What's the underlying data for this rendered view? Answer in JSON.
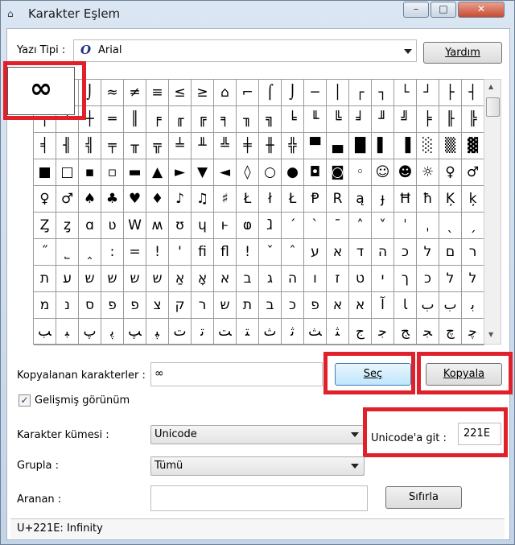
{
  "window": {
    "title": "Karakter Eşlem",
    "minimize": "–",
    "maximize": "□",
    "close": "✕"
  },
  "font": {
    "label": "Yazı Tipi :",
    "value": "Arial",
    "icon_glyph": "O",
    "help_button": "Yardım"
  },
  "grid": {
    "zoom_char": "∞",
    "rows": [
      [
        "",
        "∩",
        "⌡",
        "≈",
        "≠",
        "≡",
        "≤",
        "≥",
        "⌂",
        "⌐",
        "⌠",
        "⌡",
        "─",
        "│",
        "┌",
        "┐",
        "└",
        "┘",
        "├",
        "┤"
      ],
      [
        "┬",
        "┴",
        "┼",
        "═",
        "║",
        "╒",
        "╓",
        "╔",
        "╕",
        "╖",
        "╗",
        "╘",
        "╙",
        "╚",
        "╛",
        "╜",
        "╝",
        "╞",
        "╟",
        "╠"
      ],
      [
        "╡",
        "╢",
        "╣",
        "╤",
        "╥",
        "╦",
        "╧",
        "╨",
        "╩",
        "╪",
        "╫",
        "╬",
        "▀",
        "▄",
        "█",
        "▌",
        "▐",
        "░",
        "▒",
        "▓"
      ],
      [
        "■",
        "□",
        "▪",
        "▫",
        "▬",
        "▲",
        "►",
        "▼",
        "◄",
        "◊",
        "○",
        "●",
        "◘",
        "◙",
        "◦",
        "☺",
        "☻",
        "☼",
        "♀",
        "♂"
      ],
      [
        "♀",
        "♂",
        "♠",
        "♣",
        "♥",
        "♦",
        "♪",
        "♫",
        "♯",
        "Ł",
        "ł",
        "Ł",
        "Ᵽ",
        "R",
        "ą",
        "ɟ",
        "Ħ",
        "ħ",
        "Ķ",
        "ķ"
      ],
      [
        "Ȥ",
        "ȥ",
        "ɑ",
        "ʋ",
        "W",
        "ʍ",
        "ʊ",
        "ɥ",
        "ⱶ",
        "ⱷ",
        "ⱹ",
        "ˊ",
        "ˋ",
        "ˉ",
        "˄",
        "˅",
        "ˈ",
        "ˌ",
        "ˎ",
        "ˏ"
      ],
      [
        "˝",
        "˾",
        "‸",
        ":",
        "=",
        "!",
        "'",
        "ﬁ",
        "ﬂ",
        "!",
        "ˇ",
        "ˆ",
        "ע",
        "א",
        "ד",
        "ה",
        "כ",
        "ל",
        "ם",
        "ר"
      ],
      [
        "ת",
        "ﬠ",
        "ש",
        "ש",
        "ש",
        "ש",
        "אַ",
        "אָ",
        "א",
        "ב",
        "ג",
        "ה",
        "ו",
        "ז",
        "ט",
        "י",
        "ך",
        "כ",
        "ל",
        "ל"
      ],
      [
        "מ",
        "נ",
        "ס",
        "פ",
        "פ",
        "צ",
        "ק",
        "ר",
        "ש",
        "ת",
        "ב",
        "כ",
        "פ",
        "א",
        "א",
        "ﺁ",
        "ﺎ",
        "ﺏ",
        "ﺏ",
        "ﺑ"
      ],
      [
        "ﺐ",
        "ﺒ",
        "ﭖ",
        "ﭘ",
        "ﭗ",
        "ﭙ",
        "ﺕ",
        "ﺗ",
        "ﺖ",
        "ﺘ",
        "ﺙ",
        "ﺛ",
        "ﺚ",
        "ﺜ",
        "ﺝ",
        "ﺟ",
        "ﺞ",
        "ﺠ",
        "ﭺ",
        "ﭼ"
      ]
    ]
  },
  "copy": {
    "label": "Kopyalanan karakterler :",
    "value": "∞",
    "select_button": "Seç",
    "copy_button": "Kopyala"
  },
  "advanced": {
    "checkbox_label": "Gelişmiş görünüm",
    "checked": true,
    "checkmark": "✓"
  },
  "charset": {
    "label": "Karakter kümesi :",
    "value": "Unicode"
  },
  "goto": {
    "label": "Unicode'a git :",
    "value": "221E"
  },
  "group": {
    "label": "Grupla :",
    "value": "Tümü"
  },
  "search": {
    "label": "Aranan :",
    "value": "",
    "reset_button": "Sıfırla"
  },
  "status": {
    "text": "U+221E: Infinity"
  },
  "colors": {
    "highlight_red": "#e0202a"
  }
}
